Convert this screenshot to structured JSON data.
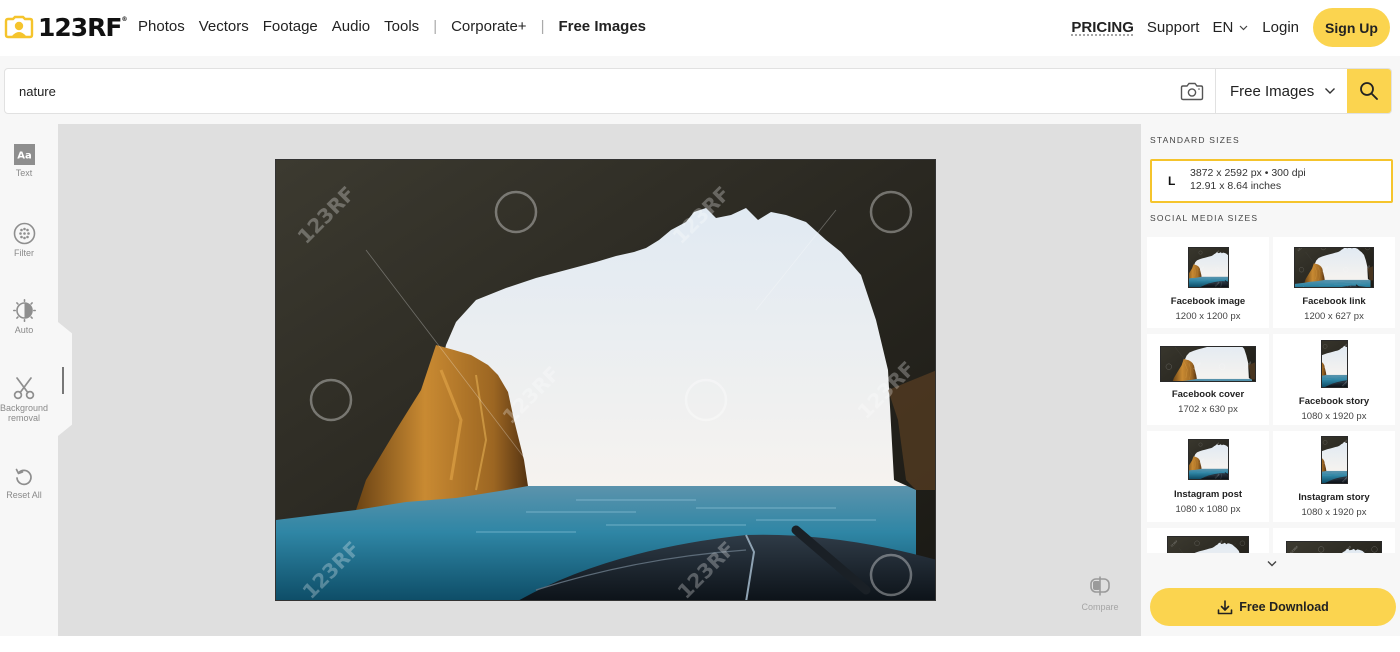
{
  "brand": {
    "name": "123RF",
    "trademark": "®",
    "accent_color": "#fbd44f",
    "highlight_border_color": "#f5c42c"
  },
  "nav": {
    "links": [
      {
        "label": "Photos"
      },
      {
        "label": "Vectors"
      },
      {
        "label": "Footage"
      },
      {
        "label": "Audio"
      },
      {
        "label": "Tools"
      }
    ],
    "separator": "|",
    "corporate_label": "Corporate+",
    "free_images_label": "Free Images",
    "pricing_label": "PRICING",
    "support_label": "Support",
    "language_label": "EN",
    "login_label": "Login",
    "signup_label": "Sign Up"
  },
  "search": {
    "value": "nature",
    "placeholder": "",
    "camera_icon": "camera-icon",
    "type_selected": "Free Images",
    "search_icon": "search-icon"
  },
  "tools": [
    {
      "label": "Text",
      "icon": "text-aa-icon"
    },
    {
      "label": "Filter",
      "icon": "filter-icon"
    },
    {
      "label": "Auto",
      "icon": "auto-contrast-icon"
    },
    {
      "label_line1": "Background",
      "label_line2": "removal",
      "icon": "scissors-icon"
    },
    {
      "label": "Reset All",
      "icon": "reset-icon"
    }
  ],
  "canvas": {
    "image_description": "View from inside a sea cave looking out at the ocean from a boat bow",
    "watermark": "123RF",
    "compare_label": "Compare"
  },
  "panel": {
    "standard_sizes_title": "STANDARD SIZES",
    "standard_size": {
      "letter": "L",
      "pixels": "3872 x 2592 px • 300 dpi",
      "inches": "12.91 x 8.64 inches"
    },
    "social_sizes_title": "SOCIAL MEDIA SIZES",
    "social_sizes": [
      {
        "name": "Facebook image",
        "dims": "1200 x 1200 px"
      },
      {
        "name": "Facebook link",
        "dims": "1200 x 627 px"
      },
      {
        "name": "Facebook cover",
        "dims": "1702 x 630 px"
      },
      {
        "name": "Facebook story",
        "dims": "1080 x 1920 px"
      },
      {
        "name": "Instagram post",
        "dims": "1080 x 1080 px"
      },
      {
        "name": "Instagram story",
        "dims": "1080 x 1920 px"
      },
      {
        "name": "",
        "dims": ""
      },
      {
        "name": "",
        "dims": ""
      }
    ],
    "download_label": "Free Download"
  }
}
